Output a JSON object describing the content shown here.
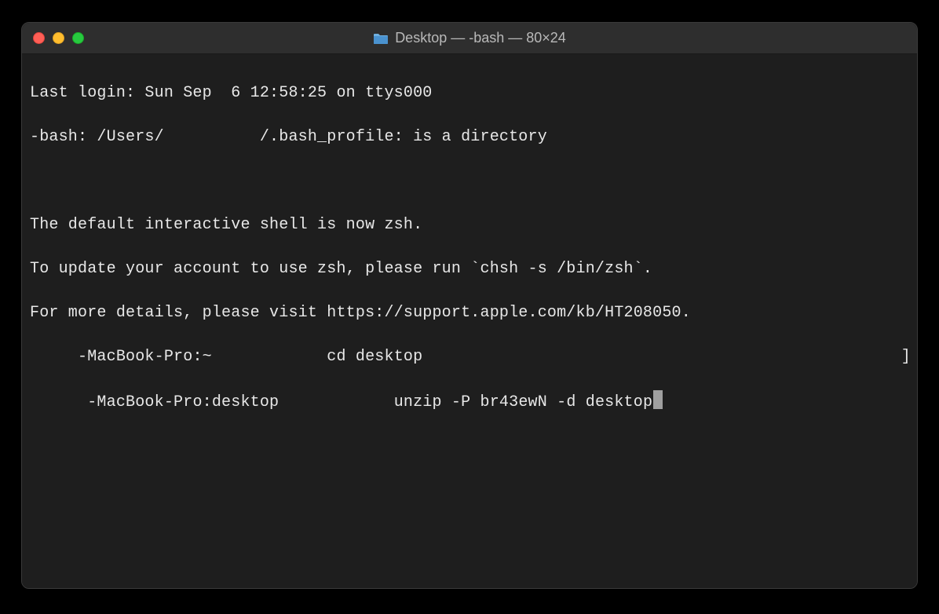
{
  "window": {
    "title": "Desktop — -bash — 80×24"
  },
  "terminal": {
    "lines": [
      "Last login: Sun Sep  6 12:58:25 on ttys000",
      "-bash: /Users/          /.bash_profile: is a directory",
      "",
      "The default interactive shell is now zsh.",
      "To update your account to use zsh, please run `chsh -s /bin/zsh`.",
      "For more details, please visit https://support.apple.com/kb/HT208050."
    ],
    "promptLine1": {
      "indent": "     ",
      "prompt": "-MacBook-Pro:~ ",
      "gap": "           ",
      "command": "cd desktop",
      "rightEdge": "]"
    },
    "promptLine2": {
      "indent": "      ",
      "prompt": "-MacBook-Pro:desktop ",
      "gap": "           ",
      "command": "unzip -P br43ewN -d desktop"
    }
  }
}
